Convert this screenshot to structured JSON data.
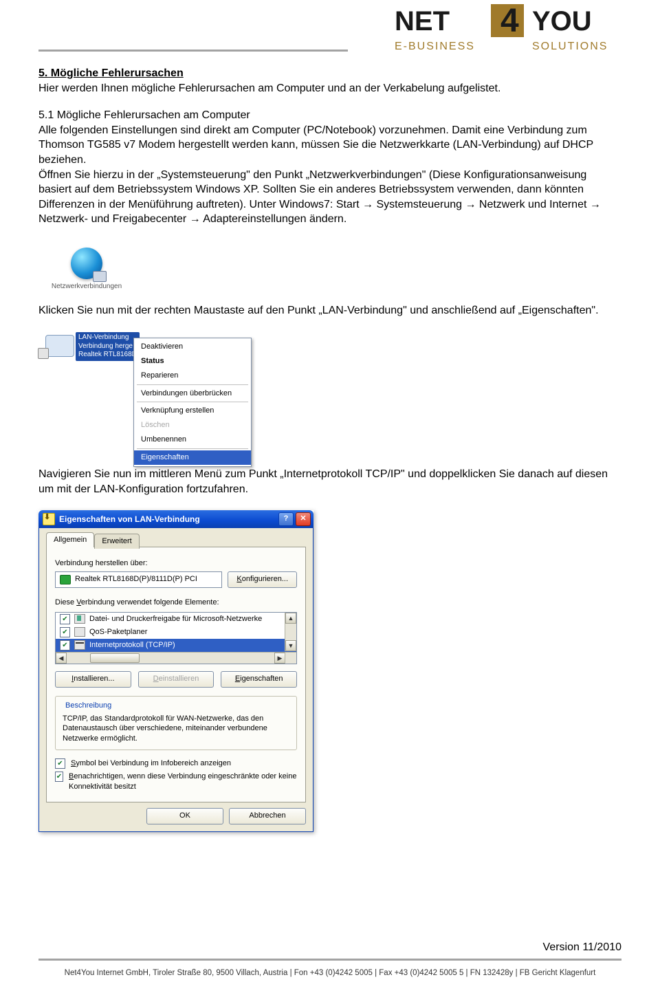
{
  "header": {
    "logo_top": "NET",
    "logo_num": "4",
    "logo_end": "YOU",
    "logo_sub_left": "E-BUSINESS",
    "logo_sub_right": "SOLUTIONS"
  },
  "section": {
    "h5": "5.  Mögliche Fehlerursachen",
    "p1": "Hier werden Ihnen mögliche Fehlerursachen am Computer und an der Verkabelung aufgelistet.",
    "h51": "5.1 Mögliche Fehlerursachen am Computer",
    "p2": "Alle folgenden Einstellungen sind direkt am Computer (PC/Notebook) vorzunehmen. Damit eine Verbindung zum Thomson TG585 v7 Modem hergestellt werden kann, müssen Sie die Netzwerkkarte (LAN-Verbindung) auf DHCP beziehen.",
    "p3": "Öffnen Sie hierzu in der „Systemsteuerung\" den Punkt „Netzwerkverbindungen\" (Diese Konfigurationsanweisung basiert auf dem Betriebssystem Windows XP. Sollten Sie ein anderes Betriebssystem verwenden, dann könnten Differenzen in der Menüführung auftreten). Unter Windows7: Start → Systemsteuerung → Netzwerk und Internet → Netzwerk- und Freigabecenter → Adaptereinstellungen ändern.",
    "fig1_caption": "Netzwerkverbindungen",
    "p4": "Klicken Sie nun mit der rechten Maustaste auf den Punkt „LAN-Verbindung\" und anschließend auf „Eigenschaften\".",
    "p5": "Navigieren Sie nun im mittleren Menü zum Punkt „Internetprotokoll TCP/IP\" und doppelklicken Sie danach auf diesen um mit der LAN-Konfiguration fortzufahren."
  },
  "lan": {
    "tooltip": "LAN-Verbindung\nVerbindung herge\nRealtek RTL8168D",
    "menu": {
      "deactivate": "Deaktivieren",
      "status": "Status",
      "repair": "Reparieren",
      "bridge": "Verbindungen überbrücken",
      "shortcut": "Verknüpfung erstellen",
      "delete": "Löschen",
      "rename": "Umbenennen",
      "properties": "Eigenschaften"
    }
  },
  "dialog": {
    "title": "Eigenschaften von LAN-Verbindung",
    "help_btn": "?",
    "close_btn": "✕",
    "tabs": {
      "general": "Allgemein",
      "extended": "Erweitert"
    },
    "conn_via_label": "Verbindung herstellen über:",
    "adapter": "Realtek RTL8168D(P)/8111D(P) PCI",
    "configure_btn": "Konfigurieren...",
    "uses_label": "Diese Verbindung verwendet folgende Elemente:",
    "items": {
      "fileshare": "Datei- und Druckerfreigabe für Microsoft-Netzwerke",
      "qos": "QoS-Paketplaner",
      "tcpip": "Internetprotokoll (TCP/IP)"
    },
    "install_btn": "Installieren...",
    "uninstall_btn": "Deinstallieren",
    "properties_btn": "Eigenschaften",
    "desc_legend": "Beschreibung",
    "desc_text": "TCP/IP, das Standardprotokoll für WAN-Netzwerke, das den Datenaustausch über verschiedene, miteinander verbundene Netzwerke ermöglicht.",
    "chk1_pre": "S",
    "chk1": "ymbol bei Verbindung im Infobereich anzeigen",
    "chk2_pre": "B",
    "chk2": "enachrichtigen, wenn diese Verbindung eingeschränkte oder keine Konnektivität besitzt",
    "ok_btn": "OK",
    "cancel_btn": "Abbrechen"
  },
  "footer": {
    "version": "Version 11/2010",
    "line": "Net4You Internet GmbH, Tiroler Straße 80, 9500 Villach, Austria  |  Fon +43 (0)4242 5005  |  Fax +43 (0)4242 5005 5  |  FN 132428y  |  FB Gericht Klagenfurt"
  }
}
